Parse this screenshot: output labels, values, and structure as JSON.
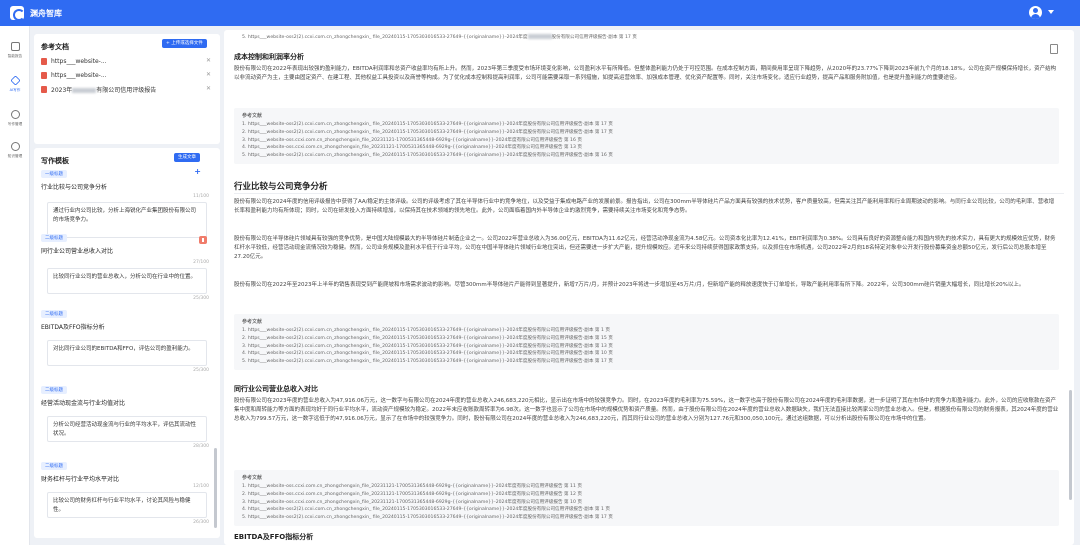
{
  "header": {
    "app_title": "渊舟智库"
  },
  "leftnav": {
    "items": [
      {
        "label": "智能报告",
        "active": false
      },
      {
        "label": "AI写作",
        "active": true
      },
      {
        "label": "写作管理",
        "active": false
      },
      {
        "label": "知识管理",
        "active": false
      }
    ]
  },
  "ref_docs": {
    "title": "参考文档",
    "upload_label": "+ 上传或选择文件",
    "items": [
      {
        "name": "https___website-..."
      },
      {
        "name": "https___website-..."
      },
      {
        "name_prefix": "2023年",
        "name_suffix": "有限公司信用评级报告"
      }
    ]
  },
  "template": {
    "title": "写作模板",
    "generate_label": "生成文章",
    "sections": [
      {
        "tag": "一级标题",
        "heading": "行业比较与公司竞争分析",
        "content": "通过行业内公司比较，分析上海锐化产业集团股份有限公司的市场竞争力。",
        "count": "",
        "level": 1
      },
      {
        "tag": "二级标题",
        "heading": "同行业公司营业总收入对比",
        "content": "比较同行业公司的营业总收入，分析公司在行业中的位置。",
        "count": "25/300",
        "count_top": "27/100",
        "level": 2
      },
      {
        "tag": "二级标题",
        "heading": "EBITDA及FFO指标分析",
        "content": "对比同行业公司的EBITDA和FFO，评估公司的盈利能力。",
        "count": "25/300",
        "count_top": "",
        "level": 2
      },
      {
        "tag": "二级标题",
        "heading": "经营活动现金流与行业均值对比",
        "content": "分析公司经营活动现金流与行业的平均水平，评估其流动性状况。",
        "count": "28/300",
        "count_top": "",
        "level": 2
      },
      {
        "tag": "二级标题",
        "heading": "财务杠杆与行业平均水平对比",
        "content": "比较公司的财务杠杆与行业平均水平，讨论其风险与稳健性。",
        "count": "26/300",
        "count_top": "12/100",
        "level": 2
      }
    ],
    "first_count": "11/100"
  },
  "doc": {
    "top_ref": "5. https___website-oss2(2).ccxi.com.cn_zhongchengxin_ file_20240115-1705303016533-27649-{{originalname}}-2024年度",
    "top_ref_suffix": "股份有限公司信用评级报告-副本  第 17 页",
    "sec1": {
      "title": "成本控制和利润率分析",
      "para": "股份有限公司在2022年表现出较强的盈利能力，EBITDA利润率和总资产收益率均有所上升。然而，2023年第三季度受市场环境变化影响，公司盈利水平有所降低。但整体盈利能力仍处于可控范围。在成本控制方面，期间费用率呈现下降趋势，从2020年的23.77%下降到2023年前九个月的18.18%，公司在资产规模保持增长，资产结构以非流动资产为主，主要由固定资产、在建工程、其他权益工具投资以及商誉等构成。为了优化成本控制和提高利润率，公司可能需要采取一系列措施，如提高运营效率、加强成本管理、优化资产配置等。同时，关注市场变化，适应行业趋势，提高产品和服务附加值，也是提升盈利能力的重要途径。",
      "ref_title": "参考文献",
      "refs": [
        "1. https___website-oss2(2).ccxi.com.cn_zhongchengxin_ file_20240115-1705303016533-27649-{{originalname}}-2024年度股份有限公司信用评级报告-副本  第 17 页",
        "2. https___website-oss2(2).ccxi.com.cn_zhongchengxin_ file_20240115-1705303016533-27649-{{originalname}}-2024年度股份有限公司信用评级报告-副本  第 17 页",
        "3. https___website-oss.ccxi.com.cn_zhongchengxin_file_20231121-1700531365448-6929g-{{originalname}}-2024年度有限公司信用评级报告  第 16 页",
        "4. https___website-oss.ccxi.com.cn_zhongchengxin_file_20231121-1700531365448-6929g-{{originalname}}-2024年度有限公司信用评级报告  第 13 页",
        "5. https___website-oss2(2).ccxi.com.cn_zhongchengxin_ file_20240115-1705303016533-27649-{{originalname}}-2024年度股份有限公司信用评级报告-副本  第 16 页"
      ]
    },
    "sec2": {
      "title": "行业比较与公司竞争分析",
      "para1": "股份有限公司在2024年度的信用评级报告中获得了AA/稳定的主体评级。公司的评级考虑了其在半导体行业中的竞争地位，以及受益于集成电路产业的发展前景。报告指出，公司在300mm半导体硅片产品方面具有较强的技术优势，客户质量较高，但需关注其产能利用率和行业周期波动的影响。与同行业公司比较，公司的毛利率、营收增长率和盈利能力均有所体现；同时，公司在研发投入方面持续增加，以保持其在技术领域的领先地位。此外，公司面临着国内外半导体企业的激烈竞争，需要持续关注市场变化和竞争态势。",
      "para2": "股份有限公司在半导体硅片领域具有较强的竞争优势，是中国大陆规模最大的半导体硅片制造企业之一。公司2022年营业总收入为36.00亿元，EBITDA为11.62亿元，经营活动净现金流为4.58亿元。公司资本化比率为12.41%，EBIT利润率为0.38%。公司具有良好的资源整合能力和国内领先的技术实力，具有更大的规模效应优势，财务杠杆水平较低，经营活动现金流情况较为稳健。然而，公司业务规模及盈利水平低于行业平均，公司在中国半导体硅片领域行业地位突出，但还需要进一步扩大产能，提升规模效应。近年来公司持续获得国家政策支持，以及抓住在市场机遇，公司2022年2月向18名特定对象非公开发行股份募集资金总额50亿元，发行后公司总股本增至27.20亿元。",
      "para3": "股份有限公司在2022年至2023年上半年的销售表现受到产能爬坡和市场需求波动的影响。尽管300mm半导体硅片产能得到显著提升，新增7万片/月，并预计2023年将进一步增加至45万片/月，但新增产能的释放速度快于订单增长，导致产能利用率有所下降。2022年，公司300mm硅片销量大幅增长，同比增长20%以上。",
      "ref_title": "参考文献",
      "refs": [
        "1. https___website-oss2(2).ccxi.com.cn_zhongchengxin_ file_20240115-1705303016533-27649-{{originalname}}-2024年度股份有限公司信用评级报告-副本  第 1 页",
        "2. https___website-oss2(2).ccxi.com.cn_zhongchengxin_ file_20240115-1705303016533-27649-{{originalname}}-2024年度股份有限公司信用评级报告-副本  第 15 页",
        "3. https___website-oss2(2).ccxi.com.cn_zhongchengxin_ file_20240115-1705303016533-27649-{{originalname}}-2024年度股份有限公司信用评级报告-副本  第 13 页",
        "4. https___website-oss2(2).ccxi.com.cn_zhongchengxin_ file_20240115-1705303016533-27649-{{originalname}}-2024年度股份有限公司信用评级报告-副本  第 10 页",
        "5. https___website-oss2(2).ccxi.com.cn_zhongchengxin_ file_20240115-1705303016533-27649-{{originalname}}-2024年度股份有限公司信用评级报告-副本  第 17 页"
      ]
    },
    "sec3": {
      "title": "同行业公司营业总收入对比",
      "para": "股份有限公司在2023年度的营业总收入为47,916.06万元，这一数字与有限公司在2024年度的营业总收入246,683,220元相比，显示出在市场中的较强竞争力。同时，在2023年度的毛利率为75.59%，这一数字也高于股份有限公司在2024年度的毛利率数据，进一步证明了其在市场中的竞争力和盈利能力。此外，公司的应收账款在资产集中度和周转能力等方面的表现均好于同行业平均水平，流动资产规模较为稳定。2022年末应收账款周转率为6.98次。这一数字也显示了公司在市场中的规模优势和资产质量。然而，由于股份有限公司在2024年度的营业总收入数据缺失，我们无法直接比较两家公司的营业总收入。但是，根据股份有限公司的财务报表，其2024年度的营业总收入为799.57万元，这一数字远低于的47,916.06万元，显示了在市场中的较强竞争力。同时，股份有限公司在2024年度的营业总收入为246,683,220元，而其同行业公司的营业总收入分别为127.76元和300,050,100元，通过这组数据，可以分析出股份有限公司在市场中的位置。",
      "ref_title": "参考文献",
      "refs": [
        "1. https___website-oss.ccxi.com.cn_zhongchengxin_file_20231121-1700531365448-6929g-{{originalname}}-2024年度有限公司信用评级报告  第 11 页",
        "2. https___website-oss.ccxi.com.cn_zhongchengxin_file_20231121-1700531365448-6929g-{{originalname}}-2024年度有限公司信用评级报告  第 12 页",
        "3. https___website-oss.ccxi.com.cn_zhongchengxin_file_20231121-1700531365448-6929g-{{originalname}}-2024年度有限公司信用评级报告  第 10 页",
        "4. https___website-oss2(2).ccxi.com.cn_zhongchengxin_ file_20240115-1705303016533-27649-{{originalname}}-2024年度股份有限公司信用评级报告-副本  第 1 页",
        "5. https___website-oss2(2).ccxi.com.cn_zhongchengxin_ file_20240115-1705303016533-27649-{{originalname}}-2024年度股份有限公司信用评级报告-副本  第 17 页"
      ]
    },
    "sec4": {
      "title": "EBITDA及FFO指标分析"
    }
  }
}
